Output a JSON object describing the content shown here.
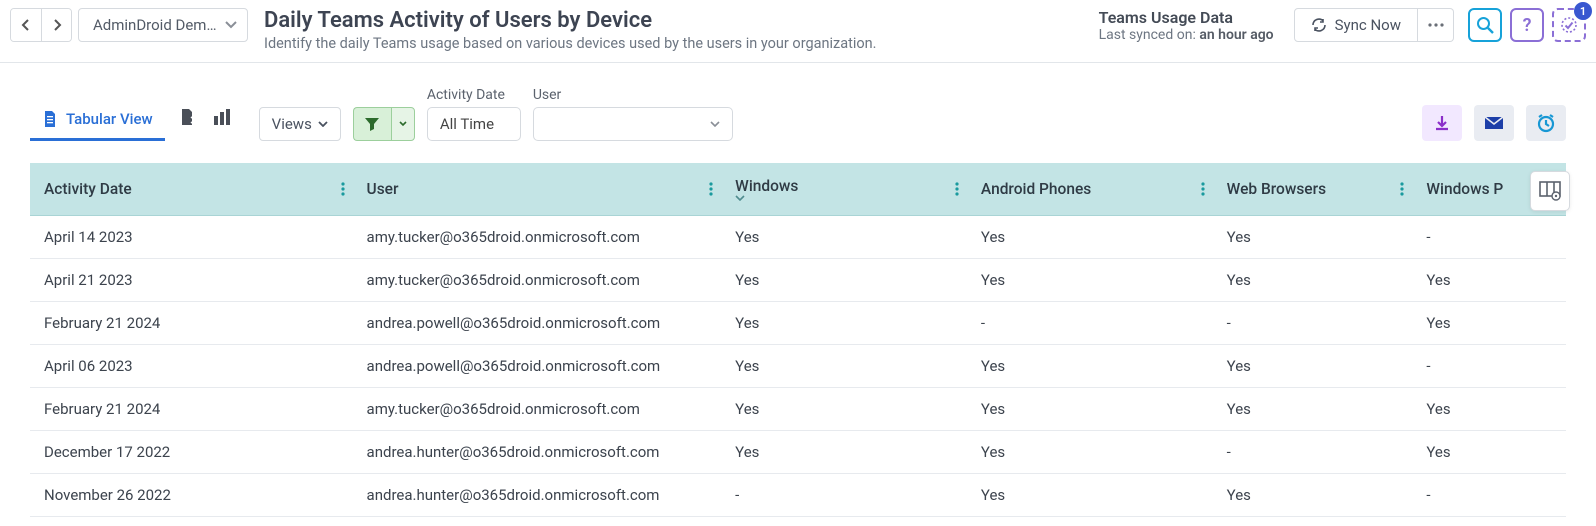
{
  "nav": {
    "breadcrumb_label": "AdminDroid Dem…"
  },
  "header": {
    "title": "Daily Teams Activity of Users by Device",
    "subtitle": "Identify the daily Teams usage based on various devices used by the users in your organization.",
    "sync_title": "Teams Usage Data",
    "sync_prefix": "Last synced on: ",
    "sync_value": "an hour ago",
    "sync_now_label": "Sync Now",
    "help_label": "?",
    "task_badge": "1"
  },
  "toolbar": {
    "tab_label": "Tabular View",
    "views_label": "Views",
    "activity_date_label": "Activity Date",
    "activity_date_value": "All Time",
    "user_label": "User",
    "user_value": ""
  },
  "table": {
    "columns": [
      {
        "key": "activity_date",
        "label": "Activity Date",
        "sorted": false
      },
      {
        "key": "user",
        "label": "User",
        "sorted": false
      },
      {
        "key": "windows",
        "label": "Windows",
        "sorted": true
      },
      {
        "key": "android",
        "label": "Android Phones",
        "sorted": false
      },
      {
        "key": "web",
        "label": "Web Browsers",
        "sorted": false
      },
      {
        "key": "winphone",
        "label": "Windows P",
        "sorted": false
      }
    ],
    "rows": [
      {
        "activity_date": "April 14 2023",
        "user": "amy.tucker@o365droid.onmicrosoft.com",
        "windows": "Yes",
        "android": "Yes",
        "web": "Yes",
        "winphone": "-"
      },
      {
        "activity_date": "April 21 2023",
        "user": "amy.tucker@o365droid.onmicrosoft.com",
        "windows": "Yes",
        "android": "Yes",
        "web": "Yes",
        "winphone": "Yes"
      },
      {
        "activity_date": "February 21 2024",
        "user": "andrea.powell@o365droid.onmicrosoft.com",
        "windows": "Yes",
        "android": "-",
        "web": "-",
        "winphone": "Yes"
      },
      {
        "activity_date": "April 06 2023",
        "user": "andrea.powell@o365droid.onmicrosoft.com",
        "windows": "Yes",
        "android": "Yes",
        "web": "Yes",
        "winphone": "-"
      },
      {
        "activity_date": "February 21 2024",
        "user": "amy.tucker@o365droid.onmicrosoft.com",
        "windows": "Yes",
        "android": "Yes",
        "web": "Yes",
        "winphone": "Yes"
      },
      {
        "activity_date": "December 17 2022",
        "user": "andrea.hunter@o365droid.onmicrosoft.com",
        "windows": "Yes",
        "android": "Yes",
        "web": "-",
        "winphone": "Yes"
      },
      {
        "activity_date": "November 26 2022",
        "user": "andrea.hunter@o365droid.onmicrosoft.com",
        "windows": "-",
        "android": "Yes",
        "web": "Yes",
        "winphone": "-"
      }
    ]
  }
}
